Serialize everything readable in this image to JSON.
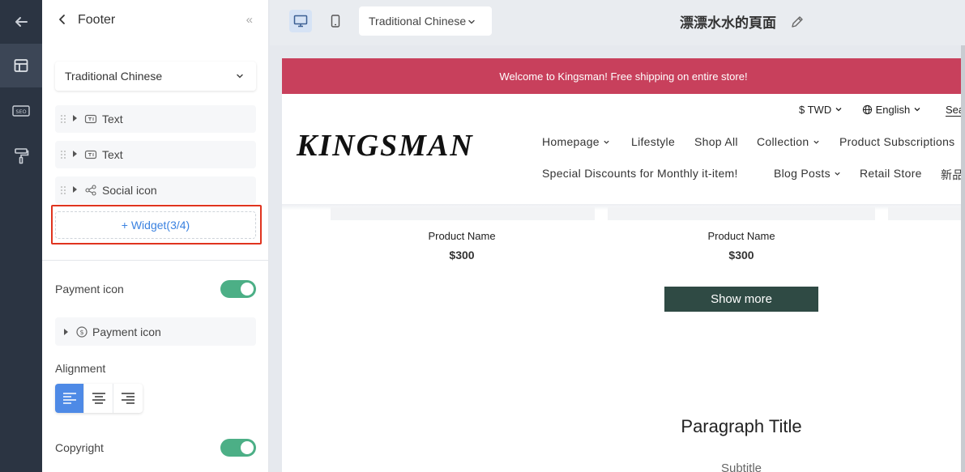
{
  "rail": {
    "icons": [
      "back-arrow-icon",
      "layout-icon",
      "seo-icon",
      "paint-roller-icon"
    ]
  },
  "panel": {
    "title": "Footer",
    "language_select": "Traditional Chinese",
    "widgets": [
      {
        "label": "Text",
        "icon": "text-widget-icon"
      },
      {
        "label": "Text",
        "icon": "text-widget-icon"
      },
      {
        "label": "Social icon",
        "icon": "share-icon"
      }
    ],
    "add_widget_label": "+ Widget(3/4)",
    "payment_icon_label": "Payment icon",
    "payment_icon_enabled": true,
    "payment_item_label": "Payment icon",
    "alignment_label": "Alignment",
    "alignment_selected": "left",
    "copyright_label": "Copyright",
    "copyright_enabled": true
  },
  "toolbar": {
    "language": "Traditional Chinese",
    "page_title": "漂漂水水的頁面",
    "device_selected": "desktop"
  },
  "preview": {
    "announcement": "Welcome to Kingsman! Free shipping on entire store!",
    "currency": "$ TWD",
    "language": "English",
    "search_partial": "Sear",
    "logo": "KINGSMAN",
    "nav_row1": [
      "Homepage",
      "Lifestyle",
      "Shop All",
      "Collection",
      "Product Subscriptions"
    ],
    "nav_row2": [
      "Special Discounts for Monthly it-item!",
      "Blog Posts",
      "Retail Store",
      "新品"
    ],
    "products": [
      {
        "name": "Product Name",
        "price": "$300"
      },
      {
        "name": "Product Name",
        "price": "$300"
      }
    ],
    "show_more": "Show more",
    "paragraph_title": "Paragraph Title",
    "subtitle": "Subtitle"
  },
  "colors": {
    "announcement_bg": "#c8405c",
    "toggle_on": "#4caf86",
    "link_blue": "#3b82e0",
    "button_dark": "#2f4a44",
    "highlight_red": "#e0341f"
  }
}
